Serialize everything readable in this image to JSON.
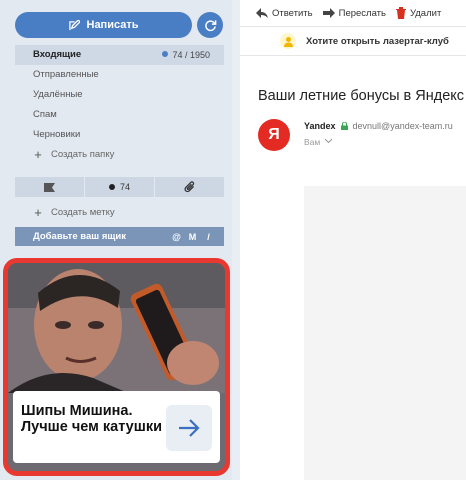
{
  "compose": {
    "label": "Написать"
  },
  "folders": [
    {
      "label": "Входящие",
      "count": "74 / 1950"
    },
    {
      "label": "Отправленные"
    },
    {
      "label": "Удалённые"
    },
    {
      "label": "Спам"
    },
    {
      "label": "Черновики"
    }
  ],
  "create_folder": "Создать папку",
  "filters": {
    "unread_count": "74"
  },
  "create_label": "Создать метку",
  "add_mailbox": "Добавьте ваш ящик",
  "ad": {
    "text": "Шипы Мишина. Лучше чем катушки"
  },
  "toolbar": {
    "reply": "Ответить",
    "forward": "Переслать",
    "delete": "Удалит"
  },
  "banner": {
    "text": "Хотите открыть лазертаг-клуб"
  },
  "email": {
    "subject": "Ваши летние бонусы в Яндекс",
    "avatar_letter": "Я",
    "sender_name": "Yandex",
    "sender_email": "devnull@yandex-team.ru",
    "to": "Вам"
  },
  "colors": {
    "accent": "#4a7ec4",
    "ad_border": "#e8382f",
    "avatar": "#e32b24"
  }
}
